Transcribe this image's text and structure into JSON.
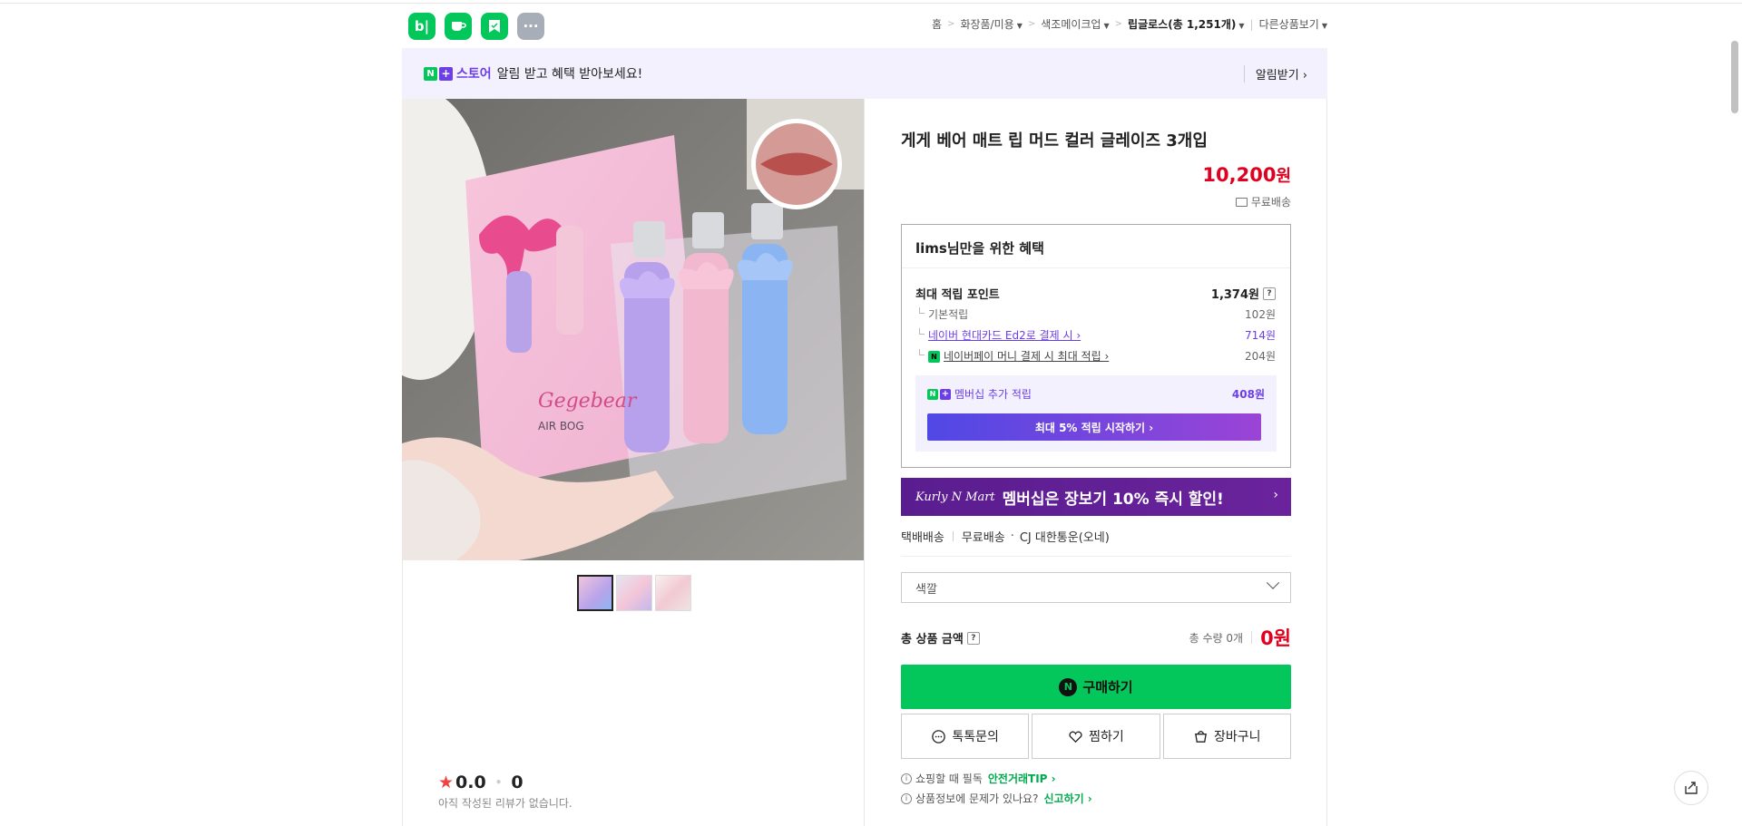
{
  "header": {
    "app_icons": [
      {
        "name": "blog-icon",
        "label": "b|"
      },
      {
        "name": "cafe-icon",
        "label": ""
      },
      {
        "name": "bookmark-icon",
        "label": ""
      },
      {
        "name": "more-icon",
        "label": "···"
      }
    ],
    "breadcrumb": {
      "home": "홈",
      "cat1": "화장품/미용",
      "cat2": "색조메이크업",
      "cat3": "립글로스(총 1,251개)",
      "other": "다른상품보기"
    }
  },
  "store_banner": {
    "n_mark": "N",
    "plus_mark": "+",
    "store_name": "스토어",
    "message": "알림 받고 혜택 받아보세요!",
    "alert_button": "알림받기 ›"
  },
  "product": {
    "title": "게게 베어 매트 립 머드 컬러 글레이즈 3개입",
    "price": "10,200",
    "price_unit": "원",
    "shipping": "무료배송"
  },
  "benefit": {
    "title": "lims님만을 위한 혜택",
    "max_point_label": "최대 적립 포인트",
    "max_point_value": "1,374원",
    "rows": [
      {
        "label": "기본적립",
        "value": "102원"
      },
      {
        "label": "네이버 현대카드 Ed2로 결제 시 ›",
        "value": "714원"
      },
      {
        "label": "네이버페이 머니 결제 시 최대 적립 ›",
        "value": "204원"
      }
    ],
    "membership_label": "멤버십 추가 적립",
    "membership_value": "408원",
    "membership_button": "최대 5% 적립 시작하기 ›"
  },
  "kurly_banner": {
    "logo": "Kurly N Mart",
    "text": "멤버십은 장보기 10% 즉시 할인!",
    "arrow": "›"
  },
  "delivery": {
    "type": "택배배송",
    "fee": "무료배송",
    "carrier": "CJ 대한통운(오네)"
  },
  "option": {
    "placeholder": "색깔"
  },
  "total": {
    "label": "총 상품 금액",
    "qty": "총 수량 0개",
    "price": "0원"
  },
  "buttons": {
    "buy": "구매하기",
    "talk": "톡톡문의",
    "wish": "찜하기",
    "cart": "장바구니"
  },
  "notices": {
    "line1": "쇼핑할 때 필독",
    "line1_link": "안전거래TIP ›",
    "line2": "상품정보에 문제가 있나요?",
    "line2_link": "신고하기 ›"
  },
  "review": {
    "score": "0.0",
    "count": "0",
    "empty_text": "아직 작성된 리뷰가 없습니다."
  },
  "colors": {
    "naver_green": "#03c75a",
    "store_purple": "#6c3ee8",
    "price_red": "#e1001f"
  }
}
